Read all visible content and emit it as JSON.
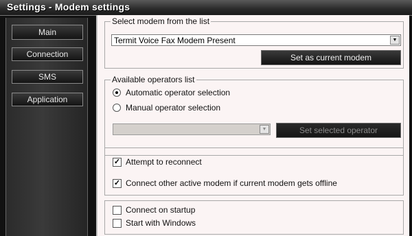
{
  "window": {
    "title": "Settings - Modem settings"
  },
  "sidebar": {
    "items": [
      {
        "label": "Main"
      },
      {
        "label": "Connection"
      },
      {
        "label": "SMS"
      },
      {
        "label": "Application"
      }
    ]
  },
  "modem_group": {
    "legend": "Select modem from the list",
    "selected_modem": "Termit Voice Fax Modem  Present",
    "set_current_label": "Set as current modem"
  },
  "operators_group": {
    "legend": "Available operators list",
    "automatic_label": "Automatic operator selection",
    "automatic_checked": true,
    "manual_label": "Manual operator selection",
    "manual_checked": false,
    "operator_value": "",
    "set_selected_label": "Set selected operator"
  },
  "reconnect_group": {
    "attempt_label": "Attempt to reconnect",
    "attempt_checked": true,
    "connect_other_label": "Connect other active modem if current modem gets offline",
    "connect_other_checked": true
  },
  "startup_group": {
    "connect_startup_label": "Connect on startup",
    "connect_startup_checked": false,
    "start_windows_label": "Start with Windows",
    "start_windows_checked": false
  },
  "icons": {
    "dropdown": "chevron-down-icon",
    "radio_selected": "radio-selected-icon",
    "checkmark": "checkmark-icon"
  }
}
